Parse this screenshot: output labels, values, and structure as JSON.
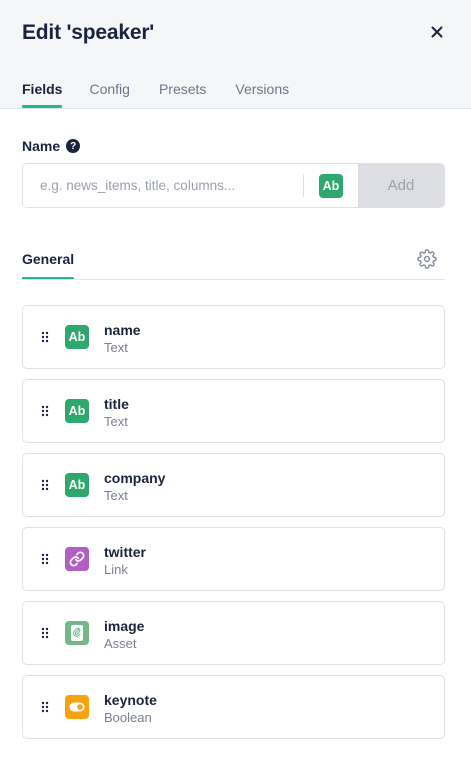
{
  "header": {
    "title": "Edit 'speaker'",
    "tabs": [
      {
        "label": "Fields",
        "active": true
      },
      {
        "label": "Config",
        "active": false
      },
      {
        "label": "Presets",
        "active": false
      },
      {
        "label": "Versions",
        "active": false
      }
    ]
  },
  "new_field": {
    "label": "Name",
    "help_icon": "question-circle-icon",
    "placeholder": "e.g. news_items, title, columns...",
    "value": "",
    "type_badge": "Ab",
    "add_label": "Add"
  },
  "section": {
    "tab_label": "General",
    "settings_icon": "gear-icon"
  },
  "fields": [
    {
      "name": "name",
      "type": "Text",
      "badge": "Ab",
      "icon": "text-icon",
      "color": "#2fa86d"
    },
    {
      "name": "title",
      "type": "Text",
      "badge": "Ab",
      "icon": "text-icon",
      "color": "#2fa86d"
    },
    {
      "name": "company",
      "type": "Text",
      "badge": "Ab",
      "icon": "text-icon",
      "color": "#2fa86d"
    },
    {
      "name": "twitter",
      "type": "Link",
      "badge": "",
      "icon": "link-icon",
      "color": "#b25ec4"
    },
    {
      "name": "image",
      "type": "Asset",
      "badge": "",
      "icon": "paperclip-icon",
      "color": "#74b887"
    },
    {
      "name": "keynote",
      "type": "Boolean",
      "badge": "",
      "icon": "toggle-icon",
      "color": "#f8a20f"
    }
  ],
  "colors": {
    "accent": "#1bb99a",
    "text_primary": "#1b243f",
    "text_secondary": "#7b8094",
    "add_disabled_bg": "#dcdee3"
  }
}
